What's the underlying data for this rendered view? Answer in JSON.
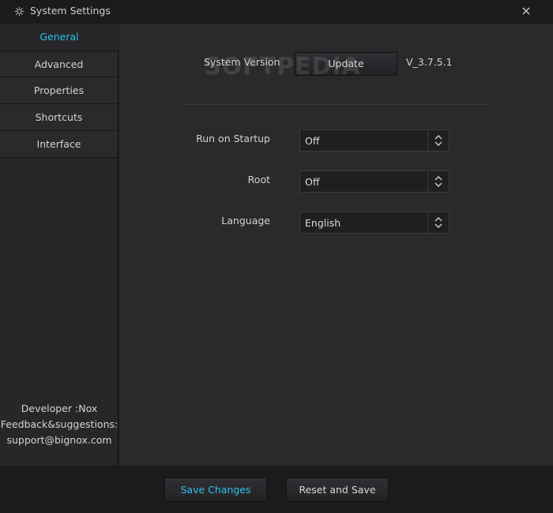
{
  "window": {
    "title": "System Settings",
    "close_label": "×"
  },
  "sidebar": {
    "items": [
      {
        "label": "General"
      },
      {
        "label": "Advanced"
      },
      {
        "label": "Properties"
      },
      {
        "label": "Shortcuts"
      },
      {
        "label": "Interface"
      }
    ],
    "developer": "Developer :Nox",
    "feedback": "Feedback&suggestions:",
    "email": "support@bignox.com"
  },
  "general": {
    "system_version_label": "System Version",
    "update_button": "Update",
    "version": "V_3.7.5.1",
    "run_on_startup": {
      "label": "Run on Startup",
      "value": "Off"
    },
    "root": {
      "label": "Root",
      "value": "Off"
    },
    "language": {
      "label": "Language",
      "value": "English"
    }
  },
  "footer": {
    "save_button": "Save Changes",
    "reset_button": "Reset and Save"
  },
  "watermark": "SOFTPEDIA",
  "colors": {
    "accent": "#2bc2e8",
    "background": "#1e1e20",
    "panel": "#2a2a2d",
    "sidebar": "#27272a"
  },
  "icons": {
    "title": "gear-icon",
    "close": "close-icon",
    "select_arrows": "up-down-chevron-icon"
  }
}
